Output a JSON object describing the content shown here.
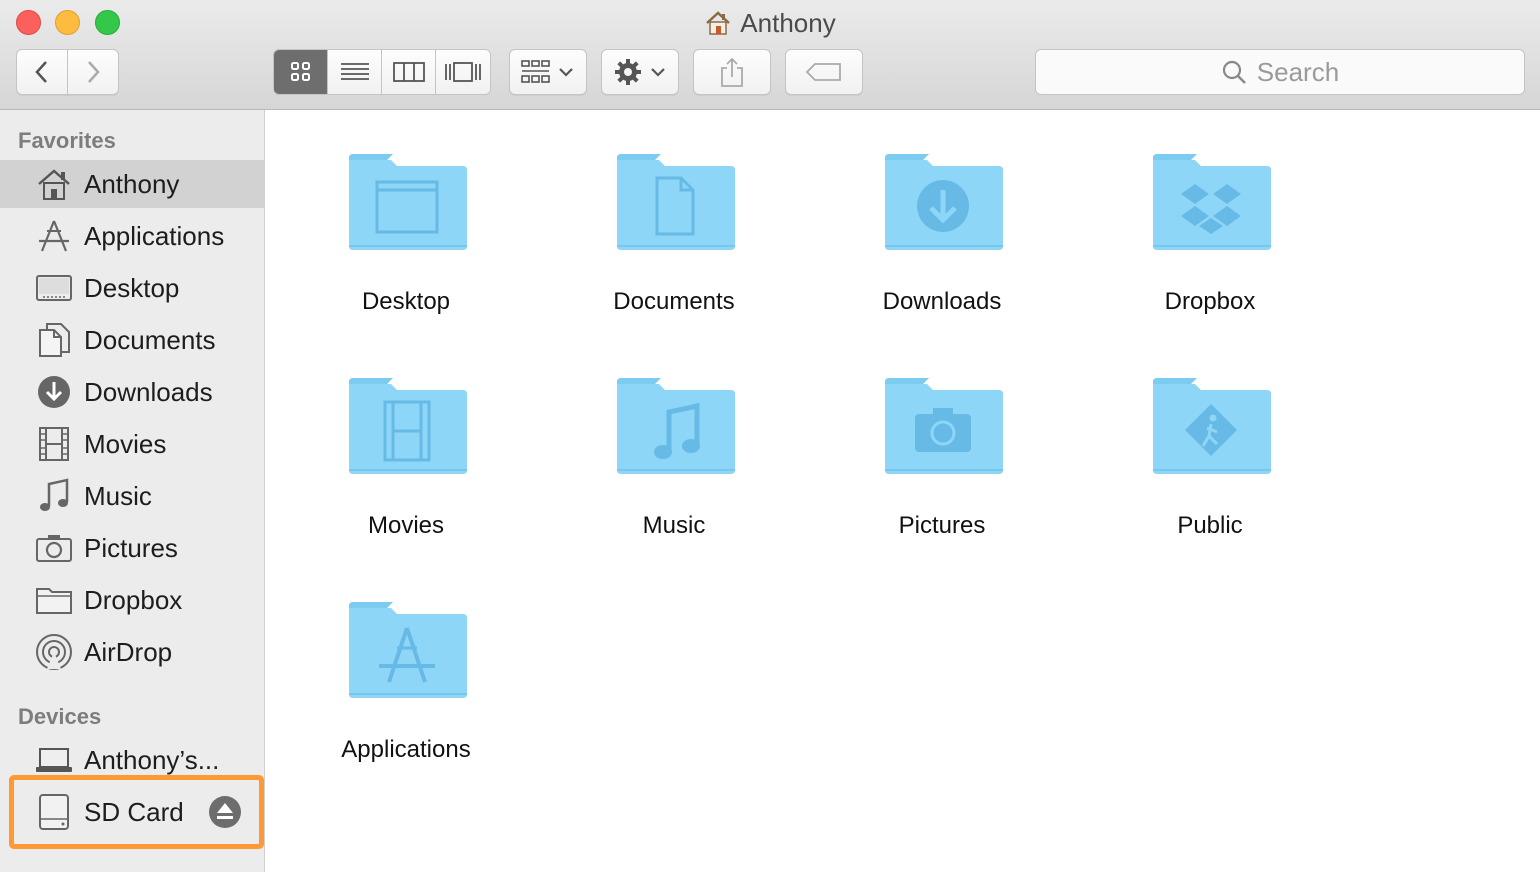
{
  "window": {
    "title": "Anthony"
  },
  "toolbar": {
    "back": "chevron-left-icon",
    "forward": "chevron-right-icon",
    "view_modes": [
      "icon-view-icon",
      "list-view-icon",
      "column-view-icon",
      "coverflow-view-icon"
    ],
    "active_view": "icon-view-icon",
    "search_placeholder": "Search"
  },
  "sidebar": {
    "favorites_header": "Favorites",
    "favorites": [
      {
        "label": "Anthony",
        "icon": "home-icon",
        "selected": true
      },
      {
        "label": "Applications",
        "icon": "applications-icon"
      },
      {
        "label": "Desktop",
        "icon": "desktop-icon"
      },
      {
        "label": "Documents",
        "icon": "documents-icon"
      },
      {
        "label": "Downloads",
        "icon": "downloads-icon"
      },
      {
        "label": "Movies",
        "icon": "movies-icon"
      },
      {
        "label": "Music",
        "icon": "music-icon"
      },
      {
        "label": "Pictures",
        "icon": "pictures-icon"
      },
      {
        "label": "Dropbox",
        "icon": "folder-icon"
      },
      {
        "label": "AirDrop",
        "icon": "airdrop-icon"
      }
    ],
    "devices_header": "Devices",
    "devices": [
      {
        "label": "Anthony’s...",
        "icon": "laptop-icon"
      },
      {
        "label": "SD Card",
        "icon": "sd-card-icon",
        "eject": true
      }
    ],
    "highlight_color": "#ff9933"
  },
  "content": {
    "items": [
      {
        "name": "Desktop",
        "glyph": "window"
      },
      {
        "name": "Documents",
        "glyph": "document"
      },
      {
        "name": "Downloads",
        "glyph": "download"
      },
      {
        "name": "Dropbox",
        "glyph": "dropbox"
      },
      {
        "name": "Movies",
        "glyph": "film"
      },
      {
        "name": "Music",
        "glyph": "note"
      },
      {
        "name": "Pictures",
        "glyph": "camera"
      },
      {
        "name": "Public",
        "glyph": "public"
      },
      {
        "name": "Applications",
        "glyph": "apps"
      }
    ]
  },
  "colors": {
    "folder_body": "#8ed6f8",
    "folder_tab": "#7ccbf1",
    "folder_glyph": "#63b7e4"
  }
}
